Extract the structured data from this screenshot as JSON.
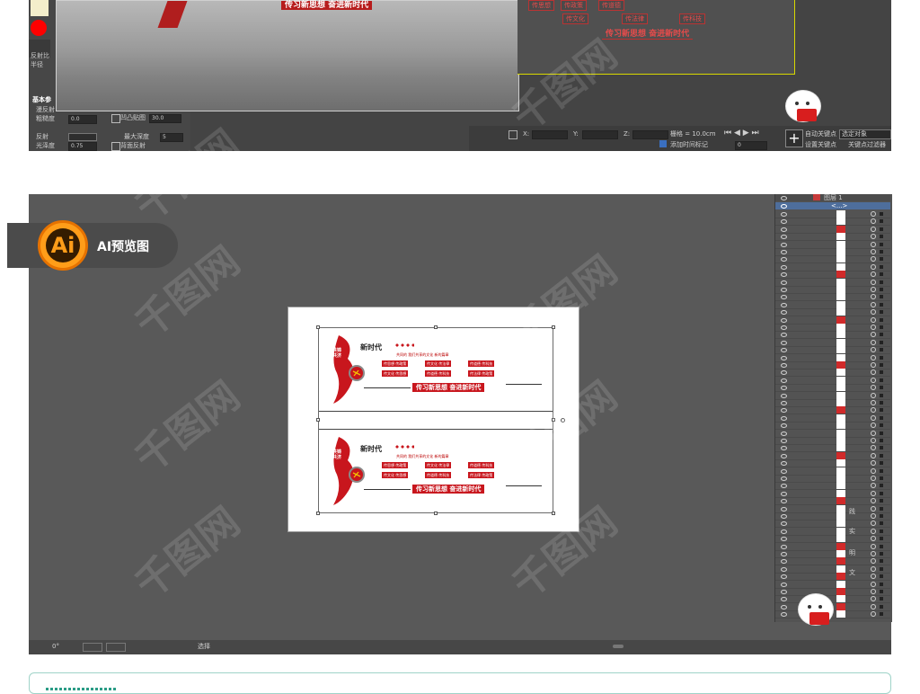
{
  "top_panel": {
    "material_props": {
      "labels": [
        "反射比",
        "半径",
        "基本参",
        "漫反射",
        "粗糙度",
        "反射",
        "光泽度",
        "最大深度",
        "背面反射"
      ],
      "roughness_value": "0.0",
      "gloss_value": "0.75",
      "max_depth_value": "5",
      "field_value_30": "30.0",
      "checkbox_label": "凹凸贴图"
    },
    "viewport_chips": {
      "row1": [
        "传思想",
        "传政策",
        "传道德"
      ],
      "row2": [
        "传文化",
        "传法律",
        "传科技"
      ],
      "slogan": "传习新思想 奋进新时代"
    },
    "render_slogan": "传习新思想 奋进新时代",
    "timebar": {
      "grid_label": "栅格 = 10.0cm",
      "time_tag_label": "添加时间标记",
      "auto_key": "自动关键点",
      "selected_object": "选定对象",
      "set_key": "设置关键点",
      "key_filter": "关键点过滤器",
      "frame_value": "0",
      "axis_x": "X:",
      "axis_y": "Y:",
      "axis_z": "Z:"
    }
  },
  "ai_preview": {
    "badge_logo": "Ai",
    "badge_label": "AI预览图",
    "banner": {
      "flag_text": "共铸\n共济",
      "title": "新时代",
      "subtitle": "共同的 我们共享的文化 新的篇章",
      "chips_row1": [
        "传思想 传政策",
        "传文化 传法律",
        "传道德 传科技"
      ],
      "chips_row2": [
        "传文化 传思想",
        "传道德 传科技",
        "传法律 传政策"
      ],
      "slogan": "传习新思想 奋进新时代"
    },
    "layers_panel": {
      "top_layer": "图层 1",
      "sublayer": "<...>",
      "side_chars": [
        "践",
        "实",
        "明",
        "文"
      ]
    },
    "status_bar": {
      "zoom": "0°",
      "tool": "选择"
    }
  },
  "watermark_text": "千图网"
}
